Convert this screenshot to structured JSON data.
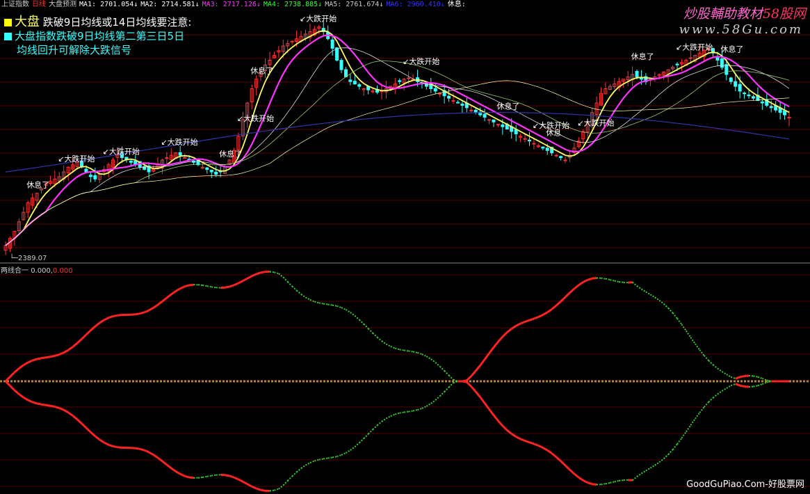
{
  "header": {
    "items": [
      {
        "text": "上证指数",
        "color": "#cccccc"
      },
      {
        "text": "日线",
        "color": "#ff3333"
      },
      {
        "text": "大盘预测",
        "color": "#cccccc"
      },
      {
        "text": "MA1: 2701.054↓",
        "color": "#ffffff"
      },
      {
        "text": "MA2: 2714.581↓",
        "color": "#ffffff"
      },
      {
        "text": "MA3: 2717.126↓",
        "color": "#ff33ff"
      },
      {
        "text": "MA4: 2738.885↓",
        "color": "#33ff33"
      },
      {
        "text": "MA5: 2761.674↓",
        "color": "#cccccc"
      },
      {
        "text": "MA6: 2960.410↓",
        "color": "#3333ff"
      },
      {
        "text": "休息:",
        "color": "#ffffff"
      }
    ]
  },
  "legend": {
    "line1_prefix": "大盘",
    "line1_text": "跌破9日均线或14日均线要注意:",
    "line2_text": "大盘指数跌破9日均线第二第三日5日",
    "line3_text": "均线回升可解除大跌信号"
  },
  "brand": {
    "text1": "炒股輔助教材",
    "text2": "58股网",
    "url": "www.58Gu.com"
  },
  "footer": {
    "text": "GoodGuPiao.Com-好股票网"
  },
  "low_price_label": "2389.07",
  "sub_indicator": {
    "name": "两线合一",
    "value1": "0.000,",
    "value2": "0.000"
  },
  "colors": {
    "up": "#ff3333",
    "down": "#33ffff",
    "ma5": "#ffff66",
    "ma10": "#ff33ff",
    "ma20": "#dddddd",
    "ma30": "#99cc66",
    "ma60": "#ffffaa",
    "ma250": "#3333aa",
    "subRed": "#ff2222",
    "subGreen": "#33cc33",
    "zeroLine": "#aa8844",
    "grid": "#aa0000"
  },
  "chart_data": {
    "type": "candlestick",
    "ylim": [
      2370,
      3380
    ],
    "low_label": "2389.07",
    "closes": [
      2420,
      2450,
      2480,
      2520,
      2560,
      2600,
      2620,
      2640,
      2660,
      2680,
      2690,
      2700,
      2710,
      2730,
      2750,
      2760,
      2770,
      2750,
      2730,
      2710,
      2700,
      2720,
      2740,
      2760,
      2780,
      2800,
      2790,
      2780,
      2770,
      2760,
      2750,
      2740,
      2730,
      2740,
      2760,
      2780,
      2790,
      2800,
      2810,
      2800,
      2790,
      2780,
      2770,
      2760,
      2750,
      2740,
      2730,
      2720,
      2730,
      2750,
      2780,
      2820,
      2880,
      2950,
      3020,
      3080,
      3120,
      3150,
      3180,
      3200,
      3220,
      3240,
      3260,
      3270,
      3280,
      3290,
      3300,
      3310,
      3320,
      3330,
      3340,
      3320,
      3290,
      3250,
      3200,
      3160,
      3130,
      3110,
      3100,
      3090,
      3080,
      3075,
      3070,
      3065,
      3070,
      3080,
      3090,
      3100,
      3110,
      3120,
      3125,
      3120,
      3110,
      3100,
      3090,
      3080,
      3070,
      3060,
      3050,
      3040,
      3030,
      3020,
      3010,
      3000,
      2990,
      2980,
      2970,
      2960,
      2950,
      2940,
      2930,
      2920,
      2910,
      2900,
      2890,
      2880,
      2870,
      2860,
      2850,
      2840,
      2830,
      2820,
      2810,
      2800,
      2790,
      2780,
      2800,
      2830,
      2860,
      2900,
      2940,
      2980,
      3020,
      3060,
      3080,
      3090,
      3100,
      3110,
      3120,
      3130,
      3140,
      3130,
      3120,
      3110,
      3120,
      3130,
      3140,
      3150,
      3160,
      3170,
      3180,
      3190,
      3200,
      3210,
      3220,
      3230,
      3240,
      3250,
      3230,
      3200,
      3170,
      3140,
      3110,
      3090,
      3070,
      3060,
      3050,
      3040,
      3030,
      3020,
      3010,
      3000,
      2990,
      2980,
      2970,
      2960
    ],
    "annotations": [
      {
        "i": 12,
        "text": "大跌开始"
      },
      {
        "i": 22,
        "text": "大跌开始"
      },
      {
        "i": 35,
        "text": "大跌开始"
      },
      {
        "i": 52,
        "text": "大跌开始"
      },
      {
        "i": 66,
        "text": "大跌开始"
      },
      {
        "i": 89,
        "text": "大跌开始"
      },
      {
        "i": 118,
        "text": "大跌开始"
      },
      {
        "i": 128,
        "text": "大跌开始"
      },
      {
        "i": 150,
        "text": "大跌开始"
      },
      {
        "i": 5,
        "text": "休息了"
      },
      {
        "i": 48,
        "text": "休息了"
      },
      {
        "i": 55,
        "text": "休息了"
      },
      {
        "i": 110,
        "text": "休息了"
      },
      {
        "i": 121,
        "text": "休息"
      },
      {
        "i": 140,
        "text": "休息了"
      },
      {
        "i": 160,
        "text": "休息了"
      }
    ]
  }
}
